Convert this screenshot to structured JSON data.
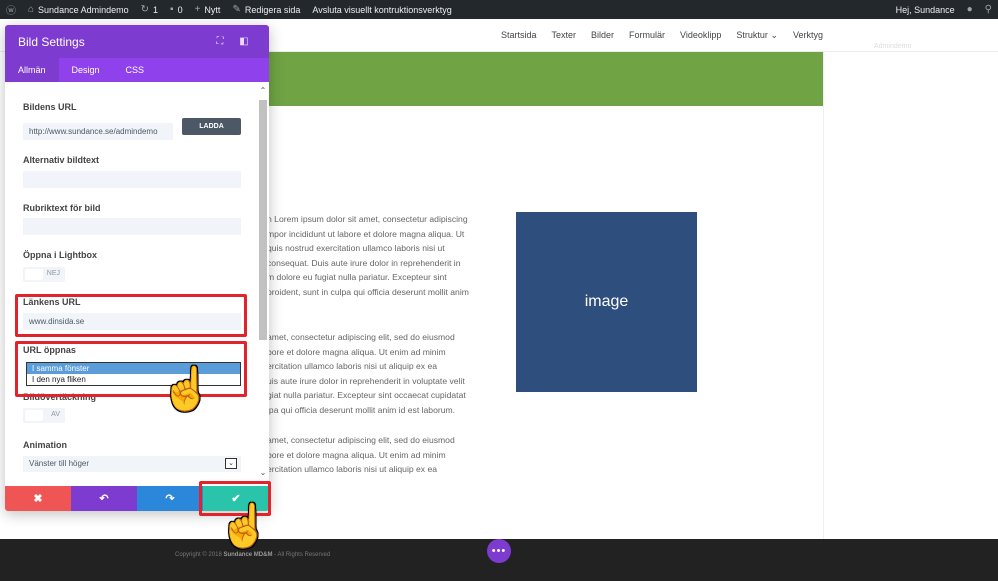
{
  "adminbar": {
    "site_name": "Sundance Admindemo",
    "updates_count": "1",
    "comments_count": "0",
    "new_label": "Nytt",
    "edit_label": "Redigera sida",
    "exit_builder_label": "Avsluta visuellt kontruktionsverktyg",
    "greeting": "Hej, Sundance"
  },
  "nav": {
    "items": [
      "Startsida",
      "Texter",
      "Bilder",
      "Formulär",
      "Videoklipp",
      "Struktur",
      "Verktyg"
    ],
    "ghost_text": "Admindemo"
  },
  "content": {
    "para1": [
      "n Lorem ipsum dolor sit amet, consectetur adipiscing",
      "mpor incididunt ut labore et dolore magna aliqua. Ut",
      "quis nostrud exercitation ullamco laboris nisi ut",
      "consequat. Duis aute irure dolor in reprehenderit in",
      "m dolore eu fugiat nulla pariatur. Excepteur sint",
      "proident, sunt in culpa qui officia deserunt mollit anim"
    ],
    "para2": [
      "amet, consectetur adipiscing elit, sed do eiusmod",
      "bore et dolore magna aliqua. Ut enim ad minim",
      "ercitation ullamco laboris nisi ut aliquip ex ea",
      "uis aute irure dolor in reprehenderit in voluptate velit",
      "giat nulla pariatur. Excepteur sint occaecat cupidatat",
      "lpa qui officia deserunt mollit anim id est laborum."
    ],
    "para3": [
      "amet, consectetur adipiscing elit, sed do eiusmod",
      "bore et dolore magna aliqua. Ut enim ad minim",
      "ercitation ullamco laboris nisi ut aliquip ex ea"
    ],
    "image_label": "image"
  },
  "footer": {
    "copyright_prefix": "Copyright © 2018",
    "copyright_brand": "Sundance MD&M",
    "copyright_suffix": "- All Rights Reserved",
    "dots": "•••"
  },
  "modal": {
    "title": "Bild Settings",
    "tabs": [
      "Allmän",
      "Design",
      "CSS"
    ],
    "fields": {
      "image_url_label": "Bildens URL",
      "image_url_value": "http://www.sundance.se/admindemo",
      "upload_label": "LADDA",
      "alt_label": "Alternativ bildtext",
      "title_label": "Rubriktext för bild",
      "lightbox_label": "Öppna i Lightbox",
      "lightbox_value": "NEJ",
      "link_url_label": "Länkens URL",
      "link_url_value": "www.dinsida.se",
      "url_opens_label": "URL öppnas",
      "url_opens_options": [
        "I samma fönster",
        "I den nya fliken"
      ],
      "overlay_label": "Bildövertäckning",
      "overlay_value": "AV",
      "animation_label": "Animation",
      "animation_value": "Vänster till höger"
    }
  },
  "colors": {
    "brand_purple": "#7e3bd0",
    "tab_purple": "#8f42ec",
    "cancel_red": "#ef5555",
    "undo_purple": "#7e3bd0",
    "redo_blue": "#2b87da",
    "save_green": "#29c4a9",
    "highlight_red": "#e1242b"
  }
}
